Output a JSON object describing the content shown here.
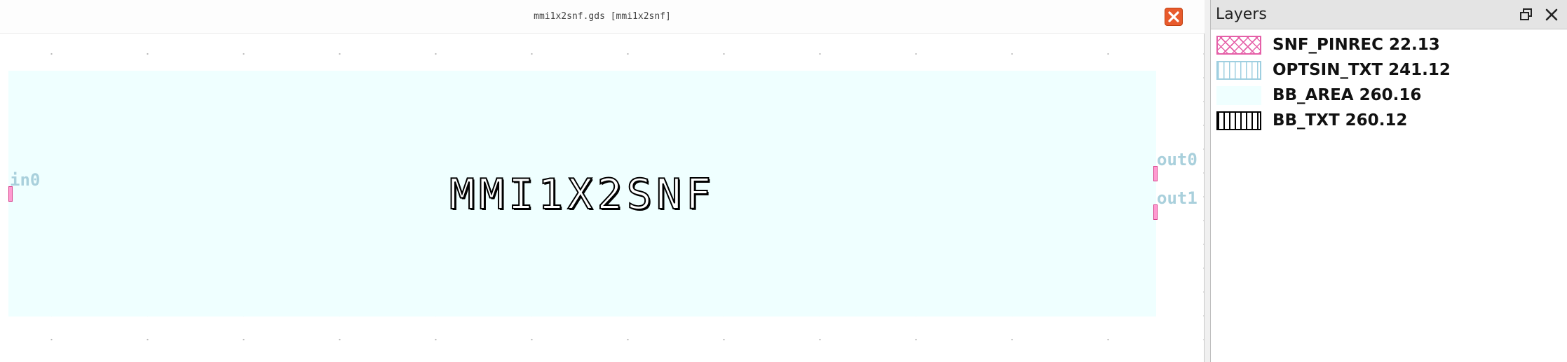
{
  "viewer": {
    "title": "mmi1x2snf.gds [mmi1x2snf]",
    "cell_label": "MMI1X2SNF",
    "pins": [
      {
        "label": "in0"
      },
      {
        "label": "out0"
      },
      {
        "label": "out1"
      }
    ],
    "colors": {
      "bb_area_fill": "#efffff",
      "pin_fill": "#ff9ad1",
      "pin_label": "#a9d0dc",
      "close_button": "#e85a2c"
    }
  },
  "layers_panel": {
    "title": "Layers",
    "layers": [
      {
        "name": "SNF_PINREC 22.13",
        "pattern": "cross-hatch",
        "color": "#e560a8"
      },
      {
        "name": "OPTSIN_TXT 241.12",
        "pattern": "vertical-lines",
        "color": "#9fcfe0"
      },
      {
        "name": "BB_AREA 260.16",
        "pattern": "solid",
        "color": "#efffff"
      },
      {
        "name": "BB_TXT 260.12",
        "pattern": "vertical-lines",
        "color": "#000000"
      }
    ]
  }
}
